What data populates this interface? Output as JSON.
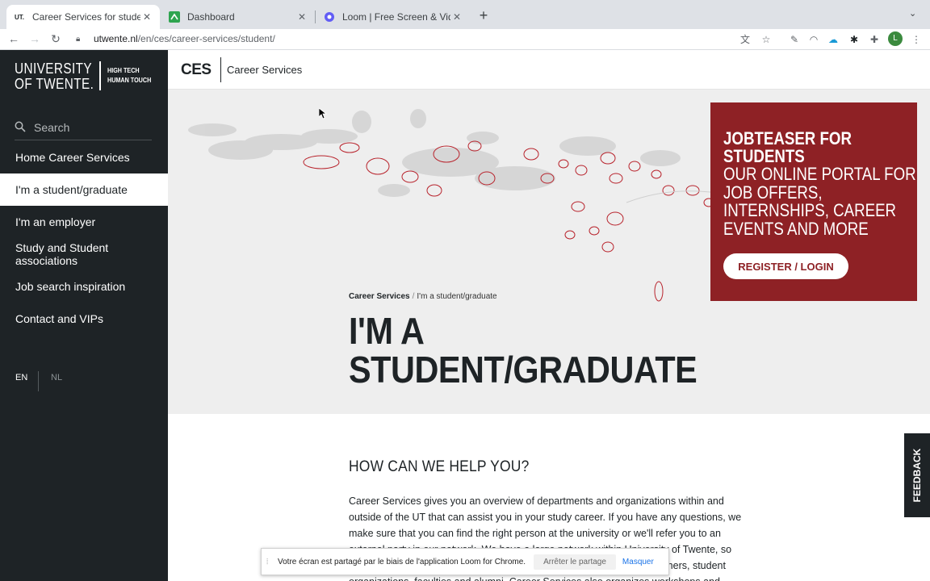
{
  "browser": {
    "tabs": [
      {
        "title": "Career Services for students: Ut",
        "favicon": "UT."
      },
      {
        "title": "Dashboard",
        "favicon": ""
      },
      {
        "title": "Loom | Free Screen & Video Re",
        "favicon": ""
      }
    ],
    "url_host": "utwente.nl",
    "url_path": "/en/ces/career-services/student/",
    "profile_initial": "L"
  },
  "sidebar": {
    "logo_line1": "UNIVERSITY",
    "logo_line2": "OF TWENTE.",
    "tagline1": "HIGH TECH",
    "tagline2": "HUMAN TOUCH",
    "search_placeholder": "Search",
    "items": [
      {
        "label": "Home Career Services"
      },
      {
        "label": "I'm a student/graduate"
      },
      {
        "label": "I'm an employer"
      },
      {
        "label": "Study and Student associations"
      },
      {
        "label": "Job search inspiration"
      },
      {
        "label": "Contact and VIPs"
      }
    ],
    "active_index": 1,
    "languages": [
      "EN",
      "NL"
    ]
  },
  "header": {
    "short": "CES",
    "title": "Career Services"
  },
  "hero": {
    "breadcrumb_root": "Career Services",
    "breadcrumb_current": "I'm a student/graduate",
    "title_line1": "I'M A",
    "title_line2": "STUDENT/GRADUATE"
  },
  "promo": {
    "line1": "JOBTEASER FOR",
    "line2": "STUDENTS",
    "line3": "OUR ONLINE PORTAL FOR",
    "line4": "JOB OFFERS,",
    "line5": "INTERNSHIPS, CAREER",
    "line6": "EVENTS AND MORE",
    "button": "REGISTER / LOGIN",
    "color": "#8e2125"
  },
  "content": {
    "heading": "HOW CAN WE HELP YOU?",
    "lines": [
      "Career Services gives you an overview of departments and organizations within and",
      "outside of the UT that can assist you in your study career. If you have any questions, we",
      "make sure that you can find the right person at the university or we'll refer you to an",
      "external party in our network. We have a large network within University of Twente, so",
      "you can also approach us with questions about connecting with researchers, student",
      "organizations, faculties and alumni. Career Services also organizes workshops and"
    ]
  },
  "feedback_label": "FEEDBACK",
  "share_bar": {
    "message": "Votre écran est partagé par le biais de l'application Loom for Chrome.",
    "stop_label": "Arrêter le partage",
    "hide_label": "Masquer"
  }
}
